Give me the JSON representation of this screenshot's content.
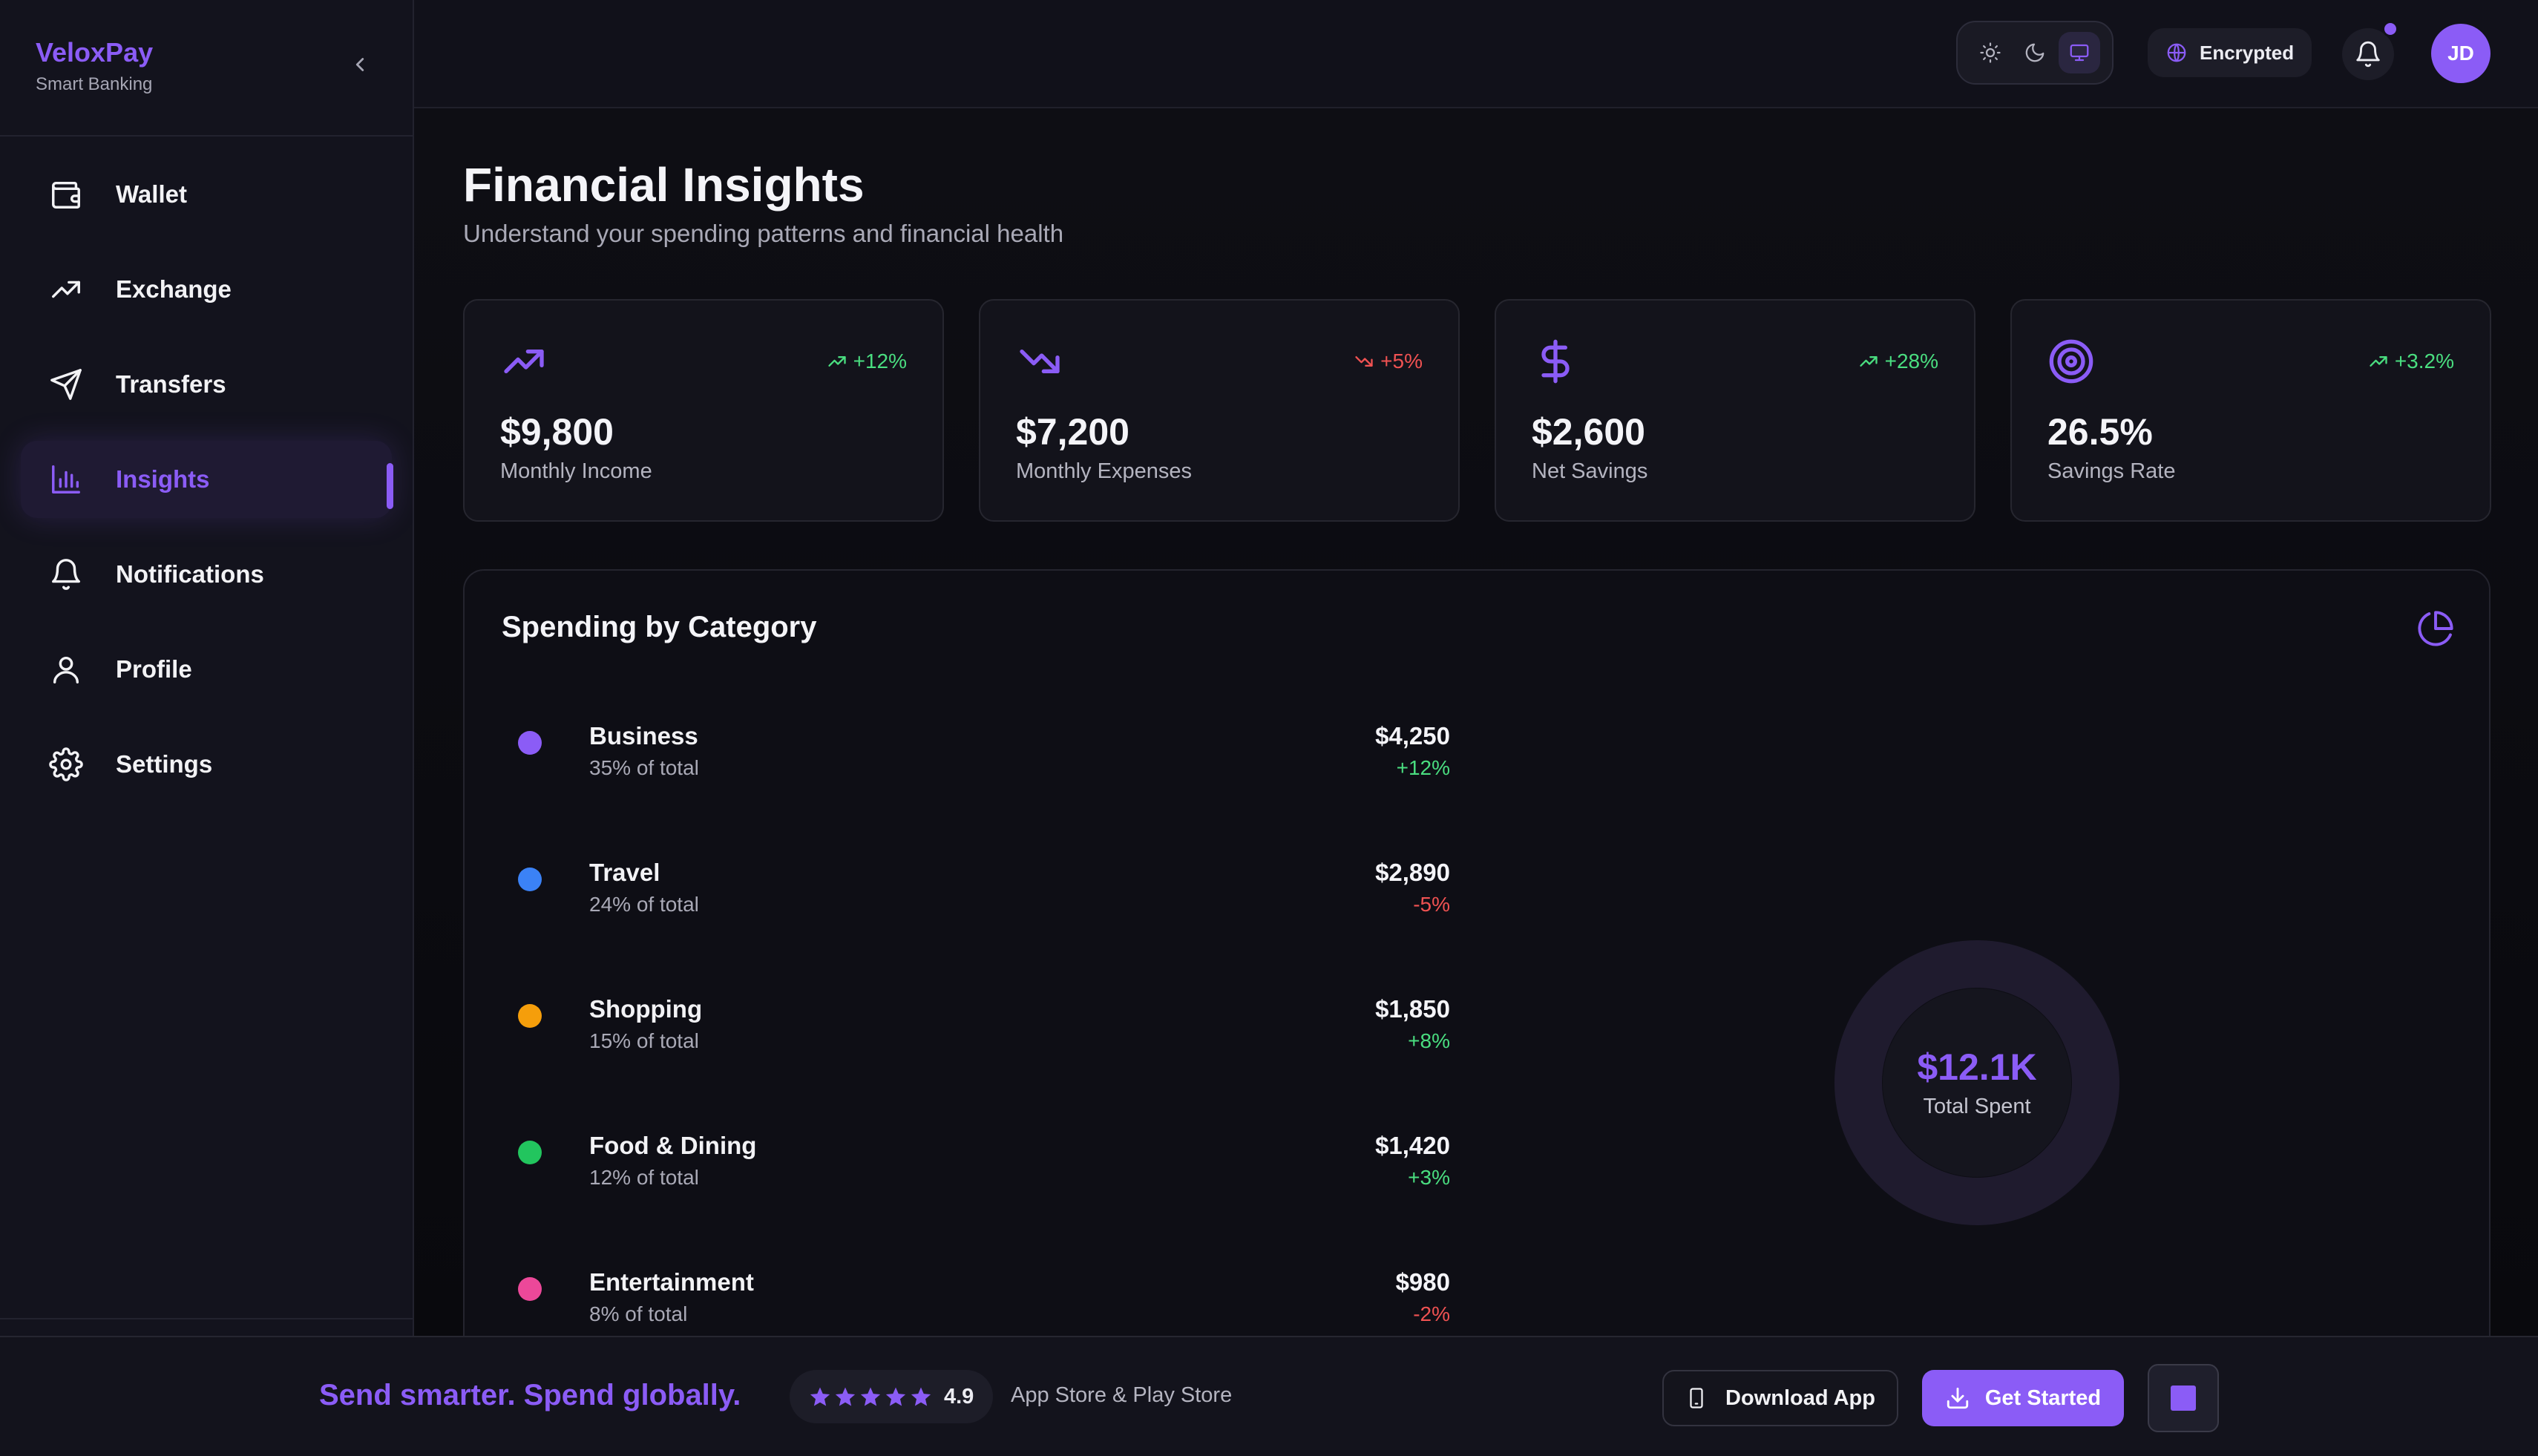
{
  "brand": {
    "name": "VeloxPay",
    "subtitle": "Smart Banking"
  },
  "sidebar": {
    "items": [
      {
        "label": "Wallet",
        "icon": "wallet-icon"
      },
      {
        "label": "Exchange",
        "icon": "trending-up-icon"
      },
      {
        "label": "Transfers",
        "icon": "send-icon"
      },
      {
        "label": "Insights",
        "icon": "bar-chart-icon",
        "active": true
      },
      {
        "label": "Notifications",
        "icon": "bell-icon"
      },
      {
        "label": "Profile",
        "icon": "user-icon"
      },
      {
        "label": "Settings",
        "icon": "gear-icon"
      }
    ]
  },
  "header": {
    "theme_options": [
      "light",
      "dark",
      "system"
    ],
    "theme_selected": "system",
    "encrypted_label": "Encrypted",
    "avatar_initials": "JD"
  },
  "page": {
    "title": "Financial Insights",
    "subtitle": "Understand your spending patterns and financial health"
  },
  "stats": [
    {
      "value": "$9,800",
      "label": "Monthly Income",
      "change": "+12%",
      "trend": "up",
      "icon": "trending-up-icon"
    },
    {
      "value": "$7,200",
      "label": "Monthly Expenses",
      "change": "+5%",
      "trend": "down",
      "icon": "trending-down-icon"
    },
    {
      "value": "$2,600",
      "label": "Net Savings",
      "change": "+28%",
      "trend": "up",
      "icon": "dollar-icon"
    },
    {
      "value": "26.5%",
      "label": "Savings Rate",
      "change": "+3.2%",
      "trend": "up",
      "icon": "target-icon"
    }
  ],
  "spending": {
    "title": "Spending by Category",
    "categories": [
      {
        "name": "Business",
        "pct": "35% of total",
        "amount": "$4,250",
        "change": "+12%",
        "trend": "up",
        "color": "#8b5cf6"
      },
      {
        "name": "Travel",
        "pct": "24% of total",
        "amount": "$2,890",
        "change": "-5%",
        "trend": "down",
        "color": "#3b82f6"
      },
      {
        "name": "Shopping",
        "pct": "15% of total",
        "amount": "$1,850",
        "change": "+8%",
        "trend": "up",
        "color": "#f59e0b"
      },
      {
        "name": "Food & Dining",
        "pct": "12% of total",
        "amount": "$1,420",
        "change": "+3%",
        "trend": "up",
        "color": "#22c55e"
      },
      {
        "name": "Entertainment",
        "pct": "8% of total",
        "amount": "$980",
        "change": "-2%",
        "trend": "down",
        "color": "#ec4899"
      }
    ],
    "total_value": "$12.1K",
    "total_label": "Total Spent"
  },
  "footer": {
    "tagline": "Send smarter. Spend globally.",
    "rating": "4.9",
    "stores": "App Store & Play Store",
    "download_label": "Download App",
    "start_label": "Get Started"
  },
  "colors": {
    "accent": "#8b5cf6",
    "positive": "#4ade80",
    "negative": "#f05252"
  }
}
